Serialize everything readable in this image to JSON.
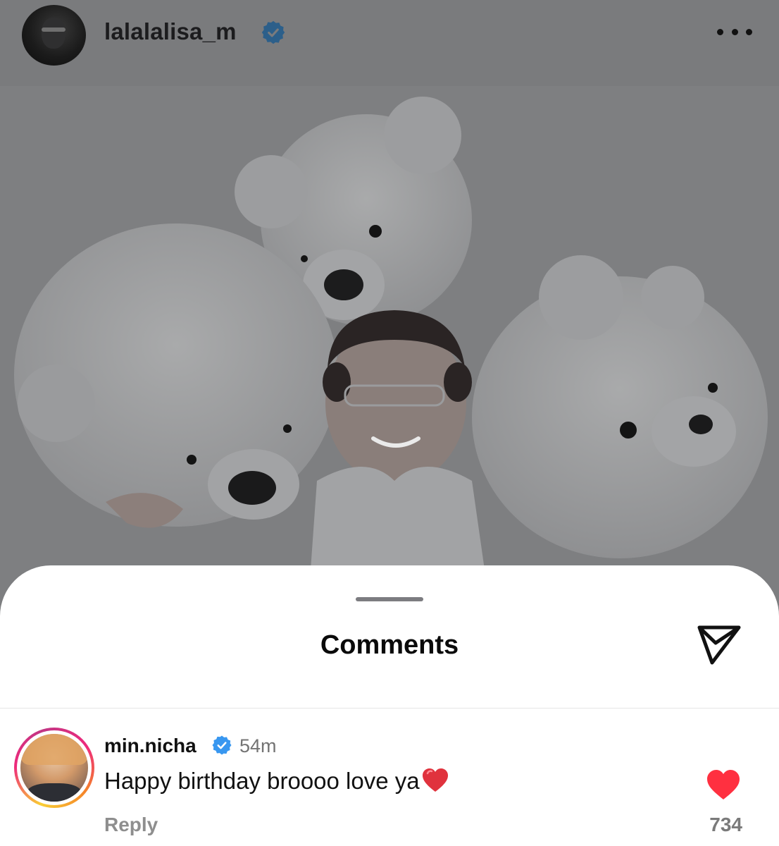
{
  "post": {
    "username": "lalalalisa_m",
    "verified": true,
    "more_icon": "more-horizontal-icon",
    "photo_alt": "post-photo"
  },
  "comments_sheet": {
    "title": "Comments",
    "share_icon": "send-icon"
  },
  "comments": [
    {
      "username": "min.nicha",
      "verified": true,
      "time": "54m",
      "text": "Happy birthday broooo love ya",
      "emoji": "❤️",
      "reply_label": "Reply",
      "likes": "734",
      "liked": true
    }
  ],
  "colors": {
    "verified_blue": "#3897f0",
    "like_red": "#ff3040",
    "overlay_gray": "#7d7e80"
  }
}
